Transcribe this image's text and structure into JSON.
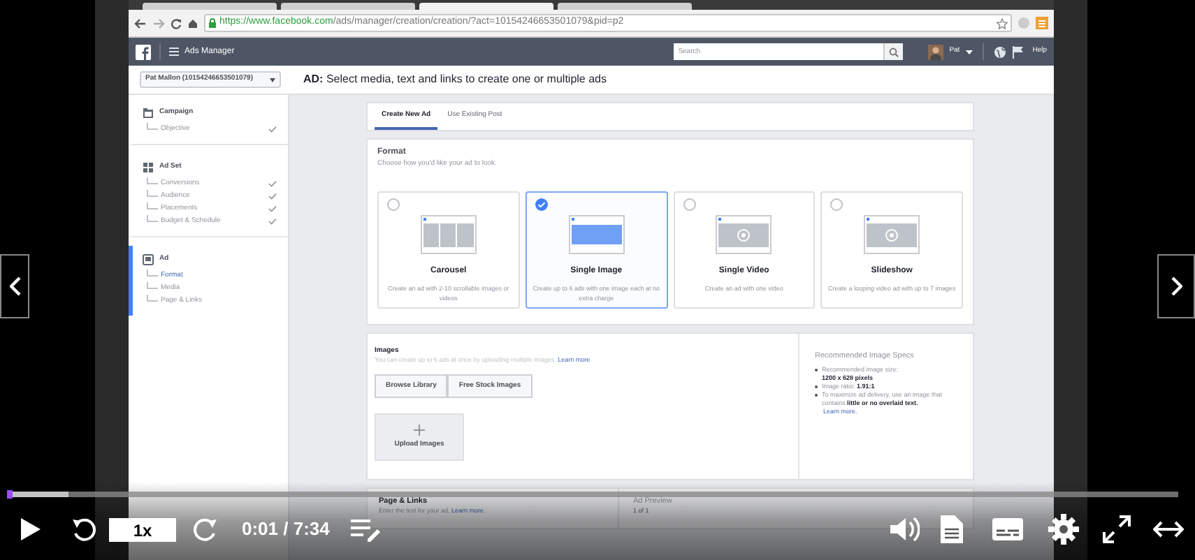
{
  "browser": {
    "tabs": [
      {
        "selected": false
      },
      {
        "selected": false
      },
      {
        "selected": true
      },
      {
        "selected": false
      }
    ],
    "url_host": "https://www.facebook.com",
    "url_path": "/ads/manager/creation/creation/?act=10154246653501079&pid=p2"
  },
  "fb_bar": {
    "title": "Ads Manager",
    "search_placeholder": "Search",
    "user": "Pat",
    "help": "Help"
  },
  "account": "Pat Mallon (10154246653501079)",
  "heading": {
    "label": "AD:",
    "text": "Select media, text and links to create one or multiple ads"
  },
  "sidebar": [
    {
      "title": "Campaign",
      "kind": "campaign",
      "selected": false,
      "children": [
        {
          "label": "Objective",
          "done": true,
          "selected": false
        }
      ]
    },
    {
      "title": "Ad Set",
      "kind": "adset",
      "selected": false,
      "children": [
        {
          "label": "Conversions",
          "done": true,
          "selected": false
        },
        {
          "label": "Audience",
          "done": true,
          "selected": false
        },
        {
          "label": "Placements",
          "done": true,
          "selected": false
        },
        {
          "label": "Budget & Schedule",
          "done": true,
          "selected": false
        }
      ]
    },
    {
      "title": "Ad",
      "kind": "ad",
      "selected": true,
      "children": [
        {
          "label": "Format",
          "done": false,
          "selected": true
        },
        {
          "label": "Media",
          "done": false,
          "selected": false
        },
        {
          "label": "Page & Links",
          "done": false,
          "selected": false
        }
      ]
    }
  ],
  "tabs": [
    {
      "label": "Create New Ad",
      "selected": true
    },
    {
      "label": "Use Existing Post",
      "selected": false
    }
  ],
  "format": {
    "title": "Format",
    "subtitle": "Choose how you'd like your ad to look.",
    "options": [
      {
        "kind": "carousel",
        "title": "Carousel",
        "description": "Create an ad with 2-10 scrollable images or videos",
        "selected": false
      },
      {
        "kind": "image",
        "title": "Single Image",
        "description": "Create up to 6 ads with one image each at no extra charge",
        "selected": true
      },
      {
        "kind": "video",
        "title": "Single Video",
        "description": "Create an ad with one video",
        "selected": false
      },
      {
        "kind": "video",
        "title": "Slideshow",
        "description": "Create a looping video ad with up to 7 images",
        "selected": false
      }
    ]
  },
  "images": {
    "title": "Images",
    "text": "You can create up to 6 ads at once by uploading multiple images.",
    "link": "Learn more",
    "buttons": [
      "Browse Library",
      "Free Stock Images"
    ],
    "upload": "Upload Images",
    "specs": {
      "title": "Recommended Image Specs",
      "items": [
        {
          "kind": "block",
          "text": "Recommended image size:",
          "value": "1200 x 628 pixels"
        },
        {
          "kind": "inline",
          "text": "Image ratio:",
          "value": "1.91:1"
        },
        {
          "kind": "inline",
          "text": "To maximize ad delivery, use an image that contains",
          "value": "little or no overlaid text."
        }
      ],
      "link": "Learn more."
    }
  },
  "page_links": {
    "title": "Page & Links",
    "text": "Enter the text for your ad.",
    "link": "Learn more."
  },
  "ad_preview": {
    "title": "Ad Preview",
    "text": "1 of 1"
  },
  "player": {
    "speed": "1x",
    "time": "0:01 / 7:34",
    "progress": {
      "level": 0.003
    }
  }
}
